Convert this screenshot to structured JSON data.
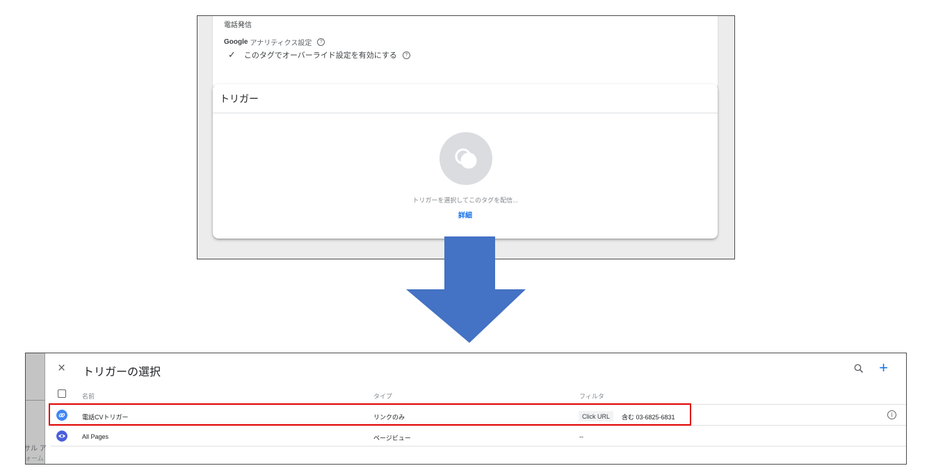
{
  "top_panel": {
    "tag_name": "電話発信",
    "ga_brand": "Google",
    "ga_label": "アナリティクス設定",
    "override_check": "✓",
    "override_label": "このタグでオーバーライド設定を有効にする",
    "help_glyph": "?",
    "trigger_title": "トリガー",
    "empty_text": "トリガーを選択してこのタグを配信...",
    "detail_link": "詳細"
  },
  "picker": {
    "close_glyph": "×",
    "title": "トリガーの選択",
    "add_glyph": "+",
    "columns": {
      "name": "名前",
      "type": "タイプ",
      "filter": "フィルタ"
    },
    "rows": [
      {
        "name": "電話CVトリガー",
        "type": "リンクのみ",
        "filter_variable": "Click URL",
        "filter_text": "含む 03-6825-6831",
        "icon": "link-icon",
        "icon_color": "#4285f4"
      },
      {
        "name": "All Pages",
        "type": "ページビュー",
        "filter_text": "--",
        "icon": "eye-icon",
        "icon_color": "#4a5fdc"
      }
    ],
    "info_glyph": "i",
    "bg_text_1": "サル ア",
    "bg_text_2": "ォーム"
  },
  "colors": {
    "arrow": "#4472c4",
    "highlight": "#e00000",
    "accent": "#1a73e8"
  }
}
